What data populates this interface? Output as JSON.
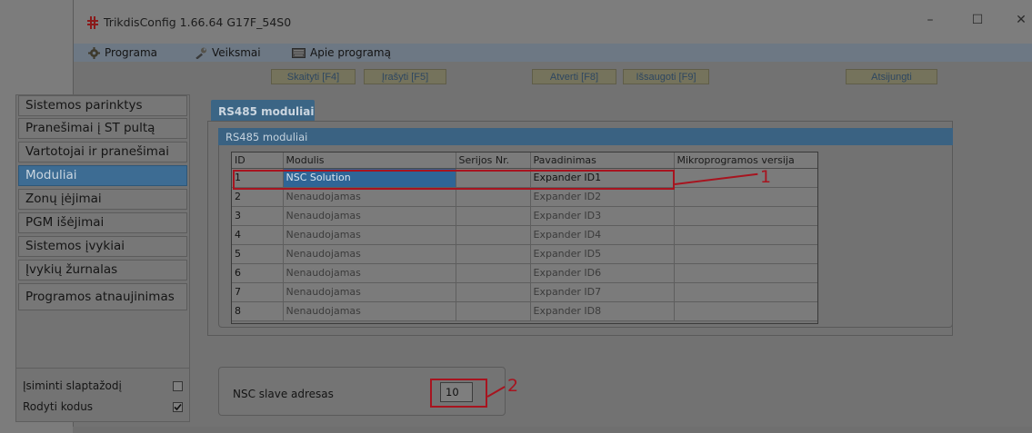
{
  "window": {
    "title": "TrikdisConfig 1.66.64   G17F_54S0",
    "controls": {
      "minimize": "–",
      "maximize": "☐",
      "close": "✕"
    }
  },
  "menu": {
    "programa": "Programa",
    "veiksmai": "Veiksmai",
    "apie": "Apie programą"
  },
  "toolbar": {
    "read": "Skaityti [F4]",
    "write": "Įrašyti [F5]",
    "open": "Atverti [F8]",
    "save": "Išsaugoti [F9]",
    "disconnect": "Atsijungti"
  },
  "sidebar": {
    "items": [
      {
        "label": "Sistemos parinktys",
        "active": false
      },
      {
        "label": "Pranešimai į ST pultą",
        "active": false
      },
      {
        "label": "Vartotojai ir pranešimai",
        "active": false
      },
      {
        "label": "Moduliai",
        "active": true
      },
      {
        "label": "Zonų įėjimai",
        "active": false
      },
      {
        "label": "PGM išėjimai",
        "active": false
      },
      {
        "label": "Sistemos įvykiai",
        "active": false
      },
      {
        "label": "Įvykių žurnalas",
        "active": false
      },
      {
        "label": "Programos atnaujinimas",
        "active": false
      }
    ],
    "options": {
      "remember_password": {
        "label": "Įsiminti slaptažodį",
        "checked": false
      },
      "show_codes": {
        "label": "Rodyti kodus",
        "checked": true
      }
    }
  },
  "tab": {
    "label": "RS485 moduliai"
  },
  "group": {
    "title": "RS485 moduliai"
  },
  "table": {
    "headers": [
      "ID",
      "Modulis",
      "Serijos Nr.",
      "Pavadinimas",
      "Mikroprogramos versija"
    ],
    "rows": [
      {
        "id": "1",
        "module": "NSC Solution",
        "serial": "",
        "name": "Expander ID1",
        "firmware": ""
      },
      {
        "id": "2",
        "module": "Nenaudojamas",
        "serial": "",
        "name": "Expander ID2",
        "firmware": ""
      },
      {
        "id": "3",
        "module": "Nenaudojamas",
        "serial": "",
        "name": "Expander ID3",
        "firmware": ""
      },
      {
        "id": "4",
        "module": "Nenaudojamas",
        "serial": "",
        "name": "Expander ID4",
        "firmware": ""
      },
      {
        "id": "5",
        "module": "Nenaudojamas",
        "serial": "",
        "name": "Expander ID5",
        "firmware": ""
      },
      {
        "id": "6",
        "module": "Nenaudojamas",
        "serial": "",
        "name": "Expander ID6",
        "firmware": ""
      },
      {
        "id": "7",
        "module": "Nenaudojamas",
        "serial": "",
        "name": "Expander ID7",
        "firmware": ""
      },
      {
        "id": "8",
        "module": "Nenaudojamas",
        "serial": "",
        "name": "Expander ID8",
        "firmware": ""
      }
    ]
  },
  "nsc": {
    "label": "NSC slave adresas",
    "value": "10"
  },
  "callouts": {
    "one": "1",
    "two": "2"
  },
  "colors": {
    "accent": "#3b6585",
    "highlight": "#a7141f",
    "selected": "#2f6596"
  }
}
